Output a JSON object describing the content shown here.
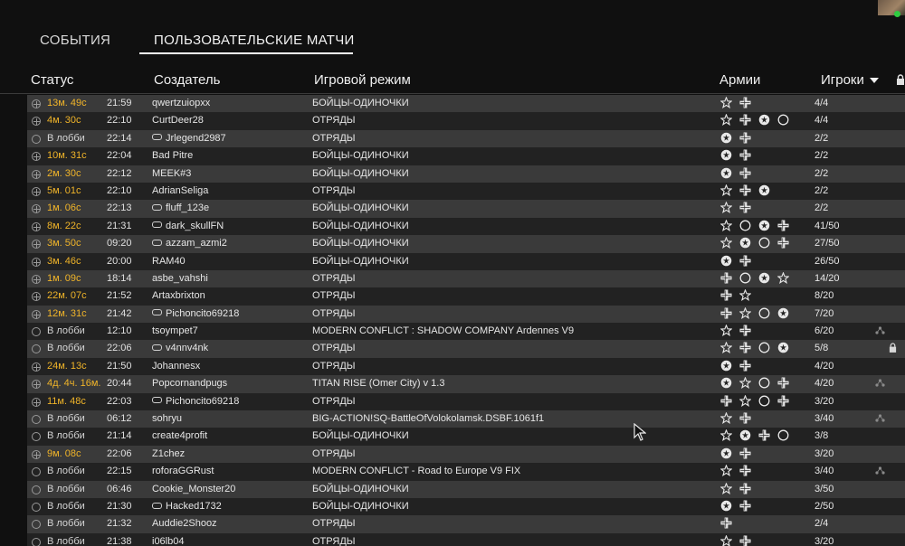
{
  "tabs": [
    {
      "label": "СОБЫТИЯ",
      "active": false
    },
    {
      "label": "ПОЛЬЗОВАТЕЛЬСКИЕ МАТЧИ",
      "active": true
    }
  ],
  "columns": {
    "status": "Статус",
    "creator": "Создатель",
    "mode": "Игровой режим",
    "armies": "Армии",
    "players": "Игроки"
  },
  "colors": {
    "timer": "#f0b429",
    "row_even": "#3a3a3a",
    "row_odd": "#222222",
    "online": "#2ecc40"
  },
  "rows": [
    {
      "status": "13м. 49с",
      "kind": "timer",
      "time": "21:59",
      "creator": "qwertzuiopxx",
      "gamepad": false,
      "mode": "БОЙЦЫ-ОДИНОЧКИ",
      "armies": [
        "star",
        "cross"
      ],
      "players": "4/4",
      "extra": "",
      "lock": false
    },
    {
      "status": "4м. 30с",
      "kind": "timer",
      "time": "22:10",
      "creator": "CurtDeer28",
      "gamepad": false,
      "mode": "ОТРЯДЫ",
      "armies": [
        "star",
        "cross",
        "badge",
        "ring"
      ],
      "players": "4/4",
      "extra": "",
      "lock": false
    },
    {
      "status": "В лобби",
      "kind": "lobby",
      "time": "22:14",
      "creator": "Jrlegend2987",
      "gamepad": true,
      "mode": "ОТРЯДЫ",
      "armies": [
        "badge",
        "cross"
      ],
      "players": "2/2",
      "extra": "",
      "lock": false
    },
    {
      "status": "10м. 31с",
      "kind": "timer",
      "time": "22:04",
      "creator": "Bad Pitre",
      "gamepad": false,
      "mode": "БОЙЦЫ-ОДИНОЧКИ",
      "armies": [
        "badge",
        "cross"
      ],
      "players": "2/2",
      "extra": "",
      "lock": false
    },
    {
      "status": "2м. 30с",
      "kind": "timer",
      "time": "22:12",
      "creator": "MEEK#3",
      "gamepad": false,
      "mode": "БОЙЦЫ-ОДИНОЧКИ",
      "armies": [
        "badge",
        "cross"
      ],
      "players": "2/2",
      "extra": "",
      "lock": false
    },
    {
      "status": "5м. 01с",
      "kind": "timer",
      "time": "22:10",
      "creator": "AdrianSeliga",
      "gamepad": false,
      "mode": "ОТРЯДЫ",
      "armies": [
        "star",
        "cross",
        "badge"
      ],
      "players": "2/2",
      "extra": "",
      "lock": false
    },
    {
      "status": "1м. 06с",
      "kind": "timer",
      "time": "22:13",
      "creator": "fluff_123e",
      "gamepad": true,
      "mode": "БОЙЦЫ-ОДИНОЧКИ",
      "armies": [
        "star",
        "cross"
      ],
      "players": "2/2",
      "extra": "",
      "lock": false
    },
    {
      "status": "8м. 22с",
      "kind": "timer",
      "time": "21:31",
      "creator": "dark_skullFN",
      "gamepad": true,
      "mode": "БОЙЦЫ-ОДИНОЧКИ",
      "armies": [
        "star",
        "ring",
        "badge",
        "cross"
      ],
      "players": "41/50",
      "extra": "",
      "lock": false
    },
    {
      "status": "3м. 50с",
      "kind": "timer",
      "time": "09:20",
      "creator": "azzam_azmi2",
      "gamepad": true,
      "mode": "БОЙЦЫ-ОДИНОЧКИ",
      "armies": [
        "star",
        "badge",
        "ring",
        "cross"
      ],
      "players": "27/50",
      "extra": "",
      "lock": false
    },
    {
      "status": "3м. 46с",
      "kind": "timer",
      "time": "20:00",
      "creator": "RAM40",
      "gamepad": false,
      "mode": "БОЙЦЫ-ОДИНОЧКИ",
      "armies": [
        "badge",
        "cross"
      ],
      "players": "26/50",
      "extra": "",
      "lock": false
    },
    {
      "status": "1м. 09с",
      "kind": "timer",
      "time": "18:14",
      "creator": "asbe_vahshi",
      "gamepad": false,
      "mode": "ОТРЯДЫ",
      "armies": [
        "cross",
        "ring",
        "badge",
        "star"
      ],
      "players": "14/20",
      "extra": "",
      "lock": false
    },
    {
      "status": "22м. 07с",
      "kind": "timer",
      "time": "21:52",
      "creator": "Artaxbrixton",
      "gamepad": false,
      "mode": "ОТРЯДЫ",
      "armies": [
        "cross",
        "star"
      ],
      "players": "8/20",
      "extra": "",
      "lock": false
    },
    {
      "status": "12м. 31с",
      "kind": "timer",
      "time": "21:42",
      "creator": "Pichoncito69218",
      "gamepad": true,
      "mode": "ОТРЯДЫ",
      "armies": [
        "cross",
        "star",
        "ring",
        "badge"
      ],
      "players": "7/20",
      "extra": "",
      "lock": false
    },
    {
      "status": "В лобби",
      "kind": "lobby",
      "time": "12:10",
      "creator": "tsoympet7",
      "gamepad": false,
      "mode": "MODERN CONFLICT : SHADOW COMPANY Ardennes V9",
      "armies": [
        "star",
        "cross"
      ],
      "players": "6/20",
      "extra": "mod",
      "lock": false
    },
    {
      "status": "В лобби",
      "kind": "lobby",
      "time": "22:06",
      "creator": "v4nnv4nk",
      "gamepad": true,
      "mode": "ОТРЯДЫ",
      "armies": [
        "star",
        "cross",
        "ring",
        "badge"
      ],
      "players": "5/8",
      "extra": "",
      "lock": true
    },
    {
      "status": "24м. 13с",
      "kind": "timer",
      "time": "21:50",
      "creator": "Johannesx",
      "gamepad": false,
      "mode": "ОТРЯДЫ",
      "armies": [
        "badge",
        "cross"
      ],
      "players": "4/20",
      "extra": "",
      "lock": false
    },
    {
      "status": "4д. 4ч. 16м.",
      "kind": "timer",
      "time": "20:44",
      "creator": "Popcornandpugs",
      "gamepad": false,
      "mode": "TITAN RISE (Omer City) v 1.3",
      "armies": [
        "badge",
        "star",
        "ring",
        "cross"
      ],
      "players": "4/20",
      "extra": "mod",
      "lock": false
    },
    {
      "status": "11м. 48с",
      "kind": "timer",
      "time": "22:03",
      "creator": "Pichoncito69218",
      "gamepad": true,
      "mode": "ОТРЯДЫ",
      "armies": [
        "cross",
        "star",
        "ring",
        "cross"
      ],
      "players": "3/20",
      "extra": "",
      "lock": false
    },
    {
      "status": "В лобби",
      "kind": "lobby",
      "time": "06:12",
      "creator": "sohryu",
      "gamepad": false,
      "mode": "BIG-ACTION!SQ-BattleOfVolokolamsk.DSBF.1061f1",
      "armies": [
        "star",
        "cross"
      ],
      "players": "3/40",
      "extra": "mod",
      "lock": false
    },
    {
      "status": "В лобби",
      "kind": "lobby",
      "time": "21:14",
      "creator": "create4profit",
      "gamepad": false,
      "mode": "БОЙЦЫ-ОДИНОЧКИ",
      "armies": [
        "star",
        "badge",
        "cross",
        "ring"
      ],
      "players": "3/8",
      "extra": "",
      "lock": false
    },
    {
      "status": "9м. 08с",
      "kind": "timer",
      "time": "22:06",
      "creator": "Z1chez",
      "gamepad": false,
      "mode": "ОТРЯДЫ",
      "armies": [
        "badge",
        "cross"
      ],
      "players": "3/20",
      "extra": "",
      "lock": false
    },
    {
      "status": "В лобби",
      "kind": "lobby",
      "time": "22:15",
      "creator": "roforaGGRust",
      "gamepad": false,
      "mode": "MODERN CONFLICT - Road to Europe V9 FIX",
      "armies": [
        "star",
        "cross"
      ],
      "players": "3/40",
      "extra": "mod",
      "lock": false
    },
    {
      "status": "В лобби",
      "kind": "lobby",
      "time": "06:46",
      "creator": "Cookie_Monster20",
      "gamepad": false,
      "mode": "БОЙЦЫ-ОДИНОЧКИ",
      "armies": [
        "star",
        "cross"
      ],
      "players": "3/50",
      "extra": "",
      "lock": false
    },
    {
      "status": "В лобби",
      "kind": "lobby",
      "time": "21:30",
      "creator": "Hacked1732",
      "gamepad": true,
      "mode": "БОЙЦЫ-ОДИНОЧКИ",
      "armies": [
        "badge",
        "cross"
      ],
      "players": "2/50",
      "extra": "",
      "lock": false
    },
    {
      "status": "В лобби",
      "kind": "lobby",
      "time": "21:32",
      "creator": "Auddie2Shooz",
      "gamepad": false,
      "mode": "ОТРЯДЫ",
      "armies": [
        "cross"
      ],
      "players": "2/4",
      "extra": "",
      "lock": false
    },
    {
      "status": "В лобби",
      "kind": "lobby",
      "time": "21:38",
      "creator": "i06lb04",
      "gamepad": false,
      "mode": "ОТРЯДЫ",
      "armies": [
        "star",
        "cross"
      ],
      "players": "3/20",
      "extra": "",
      "lock": false
    }
  ]
}
